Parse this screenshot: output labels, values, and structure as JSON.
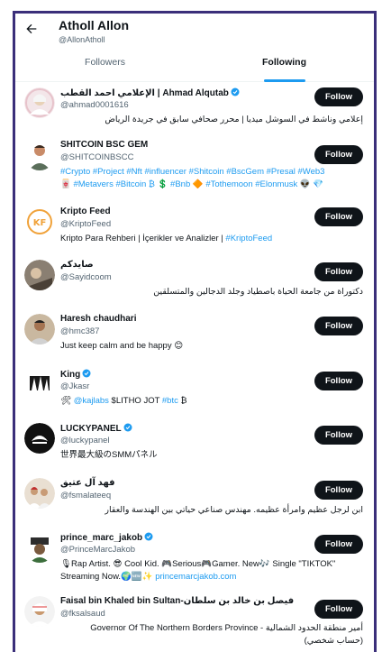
{
  "header": {
    "title": "Atholl Allon",
    "handle": "@AllonAtholl",
    "back_icon": "arrow-left-icon"
  },
  "tabs": [
    {
      "label": "Followers",
      "selected": false
    },
    {
      "label": "Following",
      "selected": true
    }
  ],
  "accent_color": "#1d9bf0",
  "follow_label": "Follow",
  "users": [
    {
      "name": "الإعلامي احمد القطب | Ahmad Alqutab",
      "verified": true,
      "handle": "@ahmad0001616",
      "bio": "إعلامي وناشط في السوشل ميديا | محرر صحافي سابق في جريدة الرياض"
    },
    {
      "name": "SHITCOIN BSC GEM",
      "verified": false,
      "handle": "@SHITCOINBSCC",
      "bio_line1": "#Crypto #Project #Nft #influencer #Shitcoin #BscGem #Presal #Web3",
      "bio_line2": "🀄 #Metavers #Bitcoin ₿ 💲 #Bnb 🔶 #Tothemoon #Elonmusk 👽 💎"
    },
    {
      "name": "Kripto Feed",
      "verified": false,
      "handle": "@KriptoFeed",
      "bio_prefix": "Kripto Para Rehberi | İçerikler ve Analizler | ",
      "bio_tag": "#KriptoFeed"
    },
    {
      "name": "صايدكم",
      "verified": false,
      "handle": "@Sayidcoom",
      "bio": "دكتوراة من جامعة الحياة باصطياد وجلد الدجالين والمتسلقين"
    },
    {
      "name": "Haresh chaudhari",
      "verified": false,
      "handle": "@hmc387",
      "bio": "Just keep calm and be happy 😊"
    },
    {
      "name": "King",
      "verified": true,
      "handle": "@Jkasr",
      "bio_prefix": "🛠 ",
      "bio_tag1": "@kajlabs",
      "bio_mid": " $LITHO ",
      "bio_mid2": "JOT ",
      "bio_tag2": "#btc",
      "bio_suffix": " ₿"
    },
    {
      "name": "LUCKYPANEL",
      "verified": true,
      "handle": "@luckypanel",
      "bio": "世界最大級のSMMパネル"
    },
    {
      "name": "فهد آل عتيق",
      "verified": false,
      "handle": "@fsmalateeq",
      "bio": "ابن لرجل عظيم وامرأة عظيمه. مهندس صناعي حياتي بين الهندسة والعقار"
    },
    {
      "name": "prince_marc_jakob",
      "verified": true,
      "handle": "@PrinceMarcJakob",
      "bio_line1": "🎙Rap Artist. 😎 Cool Kid. 🎮Serious🎮Gamer. New🎶 Single \"TIKTOK\"",
      "bio_line2_prefix": "Streaming Now.🌍🆕✨ ",
      "bio_link": "princemarcjakob.com"
    },
    {
      "name": "Faisal bin Khaled bin Sultan-فيصل بن خالد بن سلطان",
      "verified": false,
      "handle": "@fksalsaud",
      "bio_line1": "أمير منطقة الحدود الشمالية - Governor Of The Northern Borders Province",
      "bio_line2": "(حساب شخصي)"
    }
  ]
}
